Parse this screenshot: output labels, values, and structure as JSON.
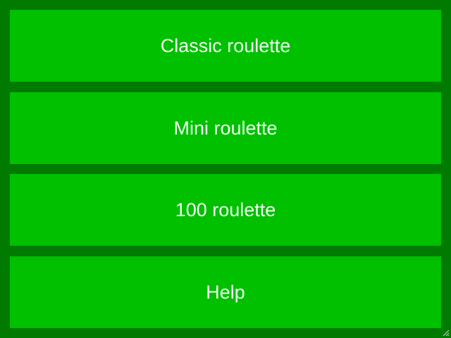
{
  "menu": {
    "items": [
      {
        "label": "Classic roulette"
      },
      {
        "label": "Mini roulette"
      },
      {
        "label": "100 roulette"
      },
      {
        "label": "Help"
      }
    ]
  },
  "colors": {
    "background": "#007a00",
    "button": "#00c000",
    "text": "#f2fff2"
  },
  "icons": {
    "resize_grip": "resize-grip-icon"
  }
}
